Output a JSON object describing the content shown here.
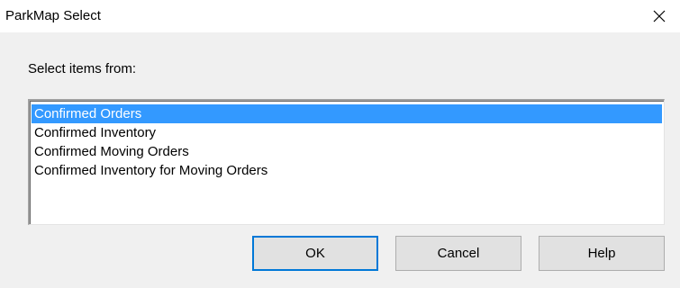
{
  "window": {
    "title": "ParkMap Select",
    "close_icon": "close-icon"
  },
  "prompt": {
    "label": "Select items from:"
  },
  "list": {
    "selected_index": 0,
    "items": [
      {
        "label": "Confirmed Orders"
      },
      {
        "label": "Confirmed Inventory"
      },
      {
        "label": "Confirmed Moving Orders"
      },
      {
        "label": "Confirmed Inventory for Moving Orders"
      }
    ]
  },
  "buttons": {
    "ok_label": "OK",
    "cancel_label": "Cancel",
    "help_label": "Help"
  },
  "colors": {
    "selection": "#3399ff",
    "default_button_border": "#0078d7",
    "dialog_background": "#f0f0f0"
  }
}
